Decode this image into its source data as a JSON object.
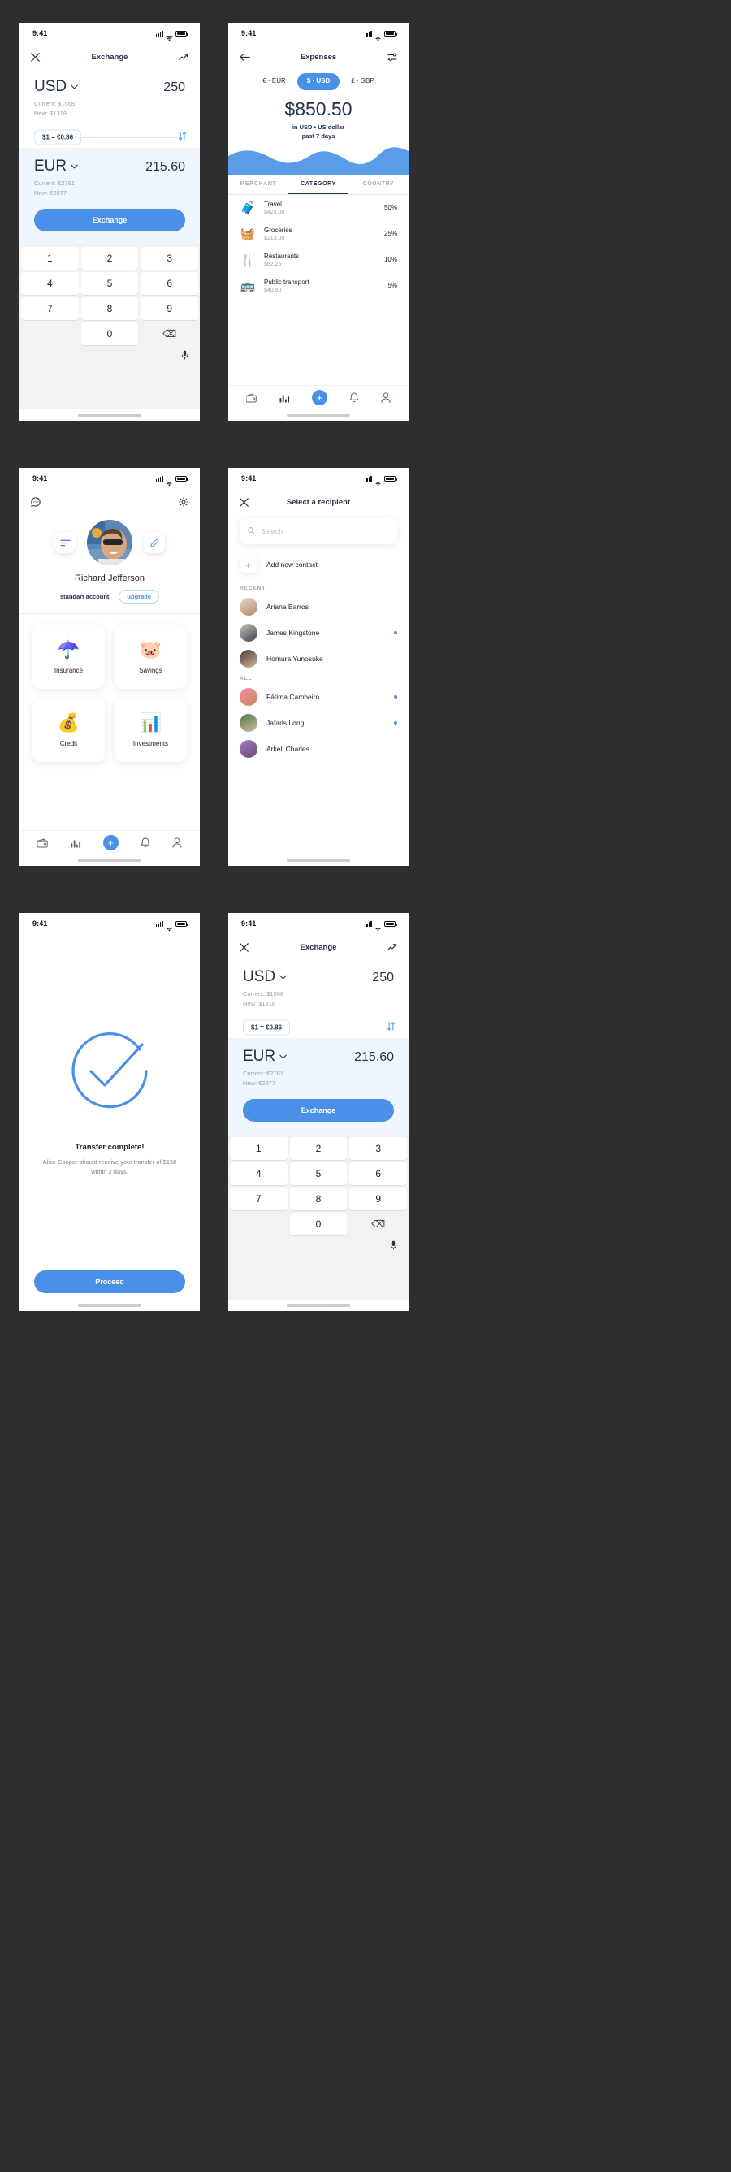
{
  "status_bar": {
    "time": "9:41"
  },
  "screens": {
    "exchange": {
      "title": "Exchange",
      "close_icon": "close-icon",
      "chart_icon": "trending-up-icon",
      "from": {
        "currency": "USD",
        "amount": "250",
        "current": "Current: $1568",
        "new": "New: $1318"
      },
      "rate": "$1 = €0.86",
      "swap_icon": "swap-vertical-icon",
      "to": {
        "currency": "EUR",
        "amount": "215.60",
        "current": "Current: €2761",
        "new": "New: €2977"
      },
      "exchange_button": "Exchange",
      "keypad": [
        "1",
        "2",
        "3",
        "4",
        "5",
        "6",
        "7",
        "8",
        "9",
        "",
        "0",
        "⌫"
      ],
      "mic_icon": "microphone-icon"
    },
    "expenses": {
      "title": "Expenses",
      "back_icon": "arrow-left-icon",
      "filter_icon": "sliders-icon",
      "segments": [
        {
          "label": "€ · EUR",
          "active": false
        },
        {
          "label": "$ · USD",
          "active": true
        },
        {
          "label": "£ · GBP",
          "active": false
        }
      ],
      "total": "$850.50",
      "subtitle": "in USD • US dollar",
      "period": "past 7 days",
      "tabs": [
        {
          "label": "MERCHANT",
          "active": false
        },
        {
          "label": "CATEGORY",
          "active": true
        },
        {
          "label": "COUNTRY",
          "active": false
        }
      ],
      "categories": [
        {
          "icon": "🧳",
          "name": "Travel",
          "amount": "$425.00",
          "percent": "50%"
        },
        {
          "icon": "🧺",
          "name": "Groceries",
          "amount": "$213.00",
          "percent": "25%"
        },
        {
          "icon": "🍴",
          "name": "Restaurants",
          "amount": "$82.25",
          "percent": "10%"
        },
        {
          "icon": "🚌",
          "name": "Public transport",
          "amount": "$40.50",
          "percent": "5%"
        }
      ]
    },
    "profile": {
      "chat_icon": "chat-bubble-icon",
      "settings_icon": "gear-icon",
      "menu_icon": "menu-lines-icon",
      "edit_icon": "pencil-icon",
      "avatar": "user-avatar",
      "name": "Richard Jefferson",
      "account_type": "standart account",
      "upgrade_label": "upgrade",
      "cards": [
        {
          "icon": "☂️",
          "label": "Insurance"
        },
        {
          "icon": "🐷",
          "label": "Savings"
        },
        {
          "icon": "💰",
          "label": "Credit"
        },
        {
          "icon": "📊",
          "label": "Investments"
        }
      ]
    },
    "recipients": {
      "title": "Select a recipient",
      "close_icon": "close-icon",
      "search_placeholder": "Search",
      "search_icon": "search-icon",
      "add_contact": "Add new contact",
      "add_icon": "plus-icon",
      "section_recent": "RECENT",
      "section_all": "ALL",
      "recent": [
        {
          "name": "Ariana Barros",
          "unread": false,
          "color": "#d9c3b4"
        },
        {
          "name": "James Kingstone",
          "unread": true,
          "color": "#c8b8b0"
        },
        {
          "name": "Homura Yunosuke",
          "unread": false,
          "color": "#8f6f5c"
        }
      ],
      "all": [
        {
          "name": "Fátima Cambeiro",
          "unread": true,
          "color": "#e88ba0"
        },
        {
          "name": "Jafaris Long",
          "unread": true,
          "color": "#7a9a6c"
        },
        {
          "name": "Arkell Charles",
          "unread": false,
          "color": "#9c7ab5"
        }
      ]
    },
    "success": {
      "check_icon": "check-circle-icon",
      "title": "Transfer complete!",
      "message": "Alice Cooper should receive your transfer of $150 within 2 days.",
      "button": "Proceed"
    }
  },
  "nav": {
    "items": [
      {
        "icon": "wallet-icon",
        "active": false
      },
      {
        "icon": "bar-chart-icon",
        "active": false
      },
      {
        "icon": "plus-icon",
        "active": true
      },
      {
        "icon": "bell-icon",
        "active": false
      },
      {
        "icon": "person-icon",
        "active": false
      }
    ]
  },
  "colors": {
    "accent": "#4a90e8",
    "ink": "#24324a",
    "muted": "#9aa3ae",
    "bg": "#2e2e2e"
  }
}
